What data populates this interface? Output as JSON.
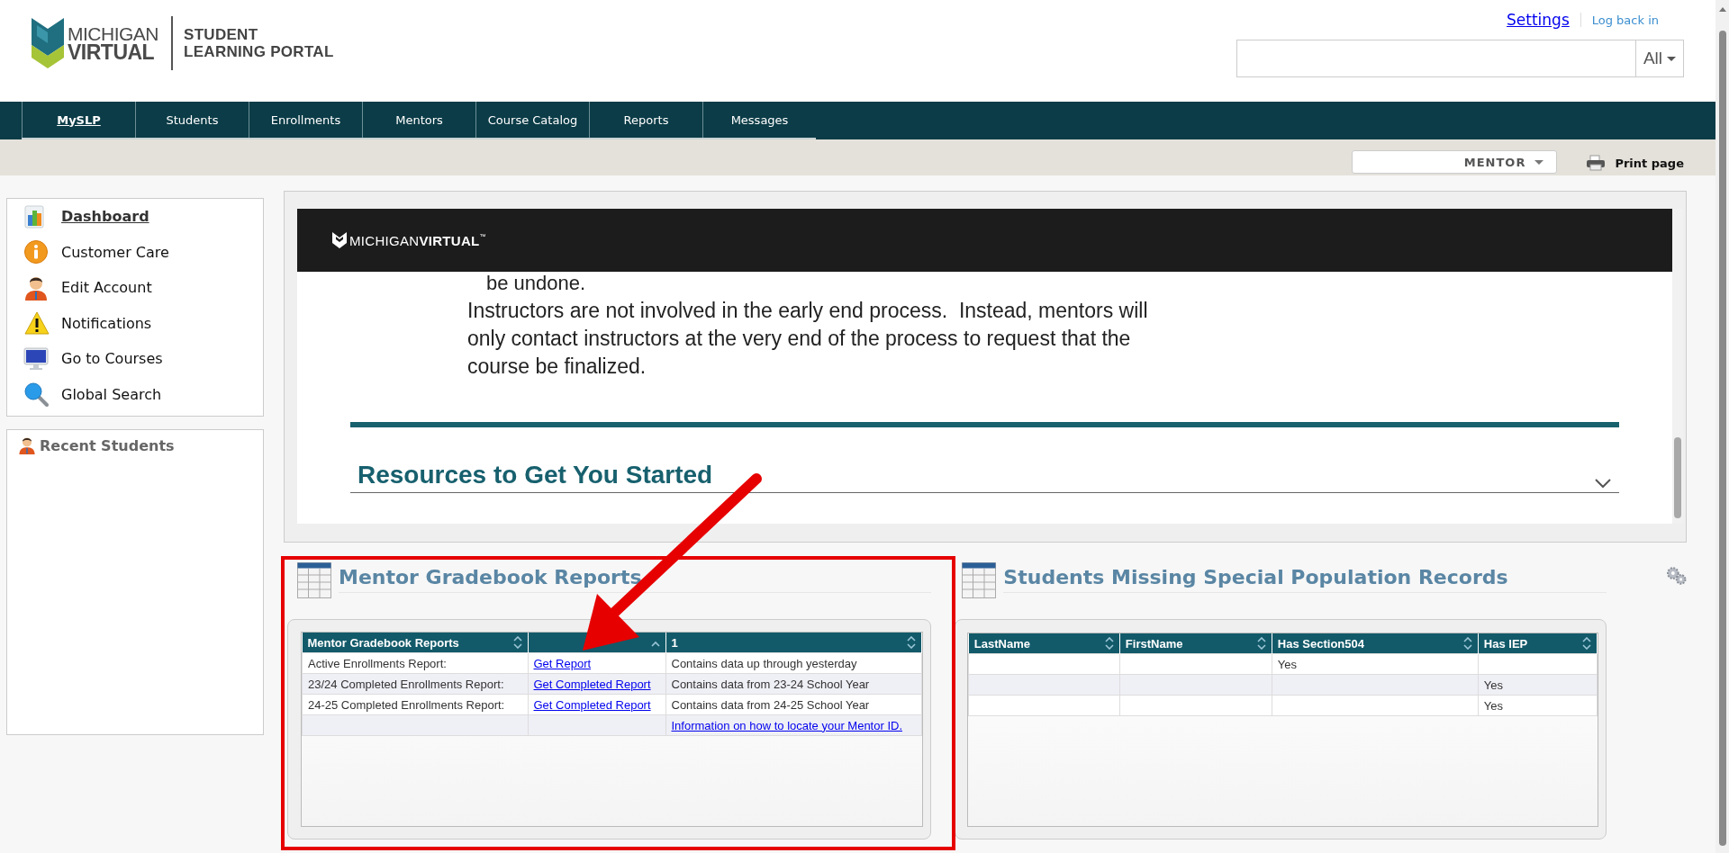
{
  "header": {
    "logo_line1": "MICHIGAN",
    "logo_line2": "VIRTUAL",
    "portal_line1": "STUDENT",
    "portal_line2": "LEARNING PORTAL",
    "links": [
      {
        "label": "Settings",
        "kind": "primary"
      },
      {
        "label": "Log back in",
        "kind": "secondary"
      }
    ],
    "search": {
      "scope": "All"
    }
  },
  "nav": {
    "tabs": [
      {
        "label": "MySLP",
        "selected": true
      },
      {
        "label": "Students",
        "selected": false
      },
      {
        "label": "Enrollments",
        "selected": false
      },
      {
        "label": "Mentors",
        "selected": false
      },
      {
        "label": "Course Catalog",
        "selected": false
      },
      {
        "label": "Reports",
        "selected": false
      },
      {
        "label": "Messages",
        "selected": false
      }
    ]
  },
  "toolbar": {
    "role": "MENTOR",
    "print": "Print page"
  },
  "sidebar": {
    "items": [
      {
        "label": "Dashboard",
        "kind": "chart",
        "selected": true
      },
      {
        "label": "Customer Care",
        "kind": "info",
        "selected": false
      },
      {
        "label": "Edit Account",
        "kind": "person",
        "selected": false
      },
      {
        "label": "Notifications",
        "kind": "warning",
        "selected": false
      },
      {
        "label": "Go to Courses",
        "kind": "monitor",
        "selected": false
      },
      {
        "label": "Global Search",
        "kind": "search",
        "selected": false
      }
    ],
    "recent_students": {
      "title": "Recent Students"
    }
  },
  "embedded_page": {
    "brand_light": "MICHIGAN",
    "brand_bold": "VIRTUAL",
    "brand_mark": "™",
    "fragment": "be undone.",
    "paragraph": "Instructors are not involved in the early end process.  Instead, mentors will only contact instructors at the very end of the process to request that the course be finalized.",
    "section_heading": "Resources to Get You Started",
    "section_expanded": false
  },
  "panels": [
    {
      "title": "Mentor Gradebook Reports",
      "table": {
        "columns": [
          {
            "label": "Mentor Gradebook Reports",
            "sort_up": true,
            "sort_down": true
          },
          {
            "sort_up": true,
            "sort_down": false
          },
          {
            "label": "1",
            "sort_up": true,
            "sort_down": true
          }
        ],
        "rows": [
          [
            {
              "text": "Active Enrollments Report:",
              "kind": "text"
            },
            {
              "text": "Get Report",
              "kind": "link"
            },
            {
              "text": "Contains data up through yesterday",
              "kind": "text"
            }
          ],
          [
            {
              "text": "23/24 Completed Enrollments Report:",
              "kind": "text"
            },
            {
              "text": "Get Completed Report",
              "kind": "link"
            },
            {
              "text": "Contains data from 23-24 School Year",
              "kind": "text"
            }
          ],
          [
            {
              "text": "24-25 Completed Enrollments Report:",
              "kind": "text"
            },
            {
              "text": "Get Completed Report",
              "kind": "link"
            },
            {
              "text": "Contains data from 24-25 School Year",
              "kind": "text"
            }
          ],
          [
            null,
            null,
            {
              "text": "Information on how to locate your Mentor ID.",
              "kind": "link"
            }
          ]
        ]
      }
    },
    {
      "title": "Students Missing Special Population Records",
      "table": {
        "columns": [
          {
            "label": "LastName",
            "sort_up": true,
            "sort_down": true
          },
          {
            "label": "FirstName",
            "sort_up": true,
            "sort_down": true
          },
          {
            "label": "Has Section504",
            "sort_up": true,
            "sort_down": true
          },
          {
            "label": "Has IEP",
            "sort_up": true,
            "sort_down": true
          }
        ],
        "rows": [
          [
            null,
            null,
            {
              "text": "Yes",
              "kind": "text"
            },
            null
          ],
          [
            null,
            null,
            null,
            {
              "text": "Yes",
              "kind": "text"
            }
          ],
          [
            null,
            null,
            null,
            {
              "text": "Yes",
              "kind": "text"
            }
          ]
        ]
      }
    }
  ]
}
